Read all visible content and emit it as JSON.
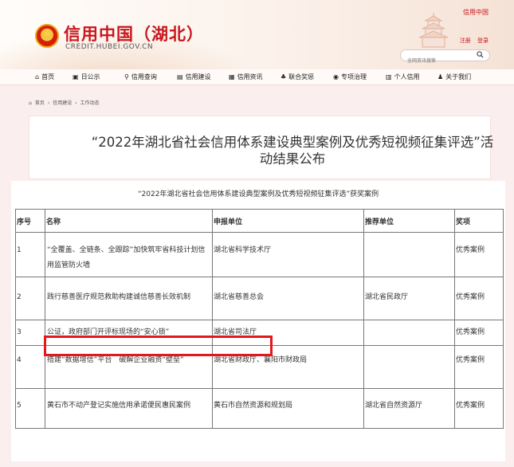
{
  "header": {
    "site_title": "信用中国（湖北）",
    "site_url": "CREDIT.HUBEI.GOV.CN",
    "top_link": "信用中国",
    "register": "注册",
    "login": "登录",
    "search_placeholder": "全网资讯搜索"
  },
  "nav": {
    "items": [
      {
        "label": "首页",
        "icon": "home-icon"
      },
      {
        "label": "日公示",
        "icon": "calendar-icon"
      },
      {
        "label": "信用查询",
        "icon": "search-icon"
      },
      {
        "label": "信用建设",
        "icon": "building-icon"
      },
      {
        "label": "信用资讯",
        "icon": "news-icon"
      },
      {
        "label": "联合奖惩",
        "icon": "people-icon"
      },
      {
        "label": "专项治理",
        "icon": "shield-icon"
      },
      {
        "label": "个人信用",
        "icon": "id-card-icon"
      },
      {
        "label": "关于我们",
        "icon": "user-icon"
      }
    ]
  },
  "breadcrumb": [
    "首页",
    "信用建设",
    "工作动态"
  ],
  "article": {
    "title": "“2022年湖北省社会信用体系建设典型案例及优秀短视频征集评选”活动结果公布",
    "caption": "“2022年湖北省社会信用体系建设典型案例及优秀短视频征集评选”获奖案例"
  },
  "table": {
    "headers": [
      "序号",
      "名称",
      "申报单位",
      "推荐单位",
      "奖项"
    ],
    "rows": [
      {
        "no": "1",
        "name": "“全覆盖、全链条、全跟踪”加快筑牢省科技计划信用监管防火墙",
        "applicant": "湖北省科学技术厅",
        "recommender": "",
        "award": "优秀案例"
      },
      {
        "no": "2",
        "name": "践行慈善医疗规范救助构建诚信慈善长效机制",
        "applicant": "湖北省慈善总会",
        "recommender": "湖北省民政厅",
        "award": "优秀案例"
      },
      {
        "no": "3",
        "name": "公证，政府部门开评标现场的“安心锁”",
        "applicant": "湖北省司法厅",
        "recommender": "",
        "award": "优秀案例"
      },
      {
        "no": "4",
        "name": "搭建“数据增信”平台　破解企业融资“壁垒”",
        "applicant": "湖北省财政厅、襄阳市财政局",
        "recommender": "",
        "award": "优秀案例"
      },
      {
        "no": "5",
        "name": "黄石市不动产登记实施信用承诺便民惠民案例",
        "applicant": "黄石市自然资源和规划局",
        "recommender": "湖北省自然资源厅",
        "award": "优秀案例"
      }
    ]
  },
  "colors": {
    "brand_red": "#c8161d",
    "highlight_red": "#e5171d",
    "background": "#fbeeee"
  }
}
